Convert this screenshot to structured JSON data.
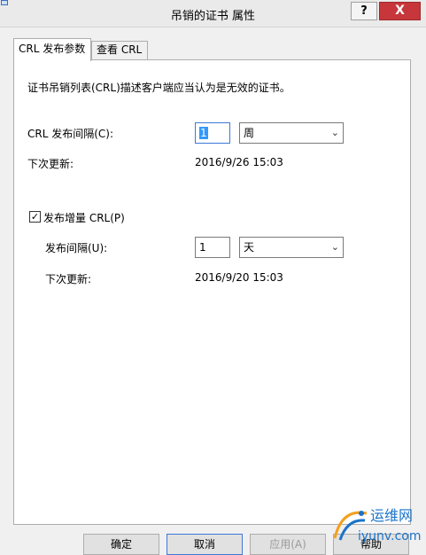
{
  "window": {
    "title": "吊销的证书 属性",
    "help_label": "?",
    "close_label": "X"
  },
  "tabs": [
    {
      "label": "CRL 发布参数",
      "active": true
    },
    {
      "label": "查看 CRL",
      "active": false
    }
  ],
  "panel": {
    "description": "证书吊销列表(CRL)描述客户端应当认为是无效的证书。",
    "crl": {
      "interval_label": "CRL 发布间隔(C):",
      "interval_value": "1",
      "interval_unit": "周",
      "next_update_label": "下次更新:",
      "next_update_value": "2016/9/26 15:03"
    },
    "delta": {
      "checkbox_label": "发布增量 CRL(P)",
      "checked": true,
      "interval_label": "发布间隔(U):",
      "interval_value": "1",
      "interval_unit": "天",
      "next_update_label": "下次更新:",
      "next_update_value": "2016/9/20 15:03"
    }
  },
  "buttons": {
    "ok": "确定",
    "cancel": "取消",
    "apply": "应用(A)",
    "help": "帮助"
  },
  "watermark": {
    "line1": "运维网",
    "line2": "iyunv.com"
  },
  "colors": {
    "close_button": "#c7363a",
    "focus_border": "#3c78d8",
    "selection": "#3399ff",
    "watermark_blue": "#1a73c9"
  }
}
